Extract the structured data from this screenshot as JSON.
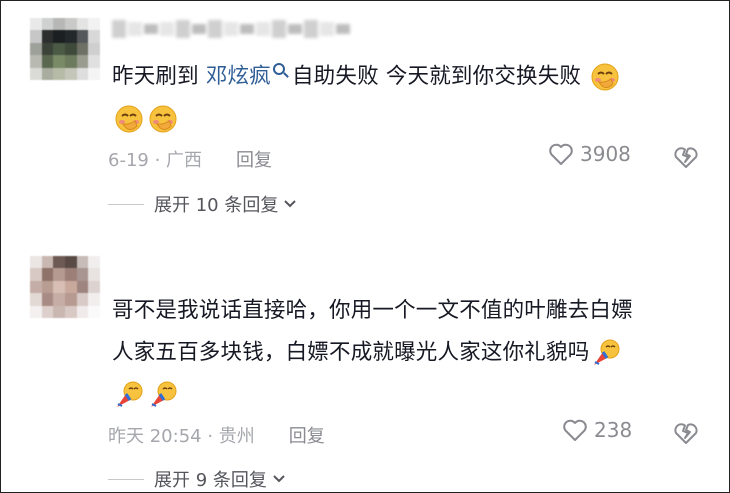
{
  "comments": [
    {
      "text_before": "昨天刷到 ",
      "mention": "邓炫疯",
      "text_after": " 自助失败 今天就到你交换失败",
      "date_location": "6-19 · 广西",
      "reply_label": "回复",
      "likes": "3908",
      "expand_label": "展开 10 条回复",
      "emoji_name": "blushing-hand-over-mouth"
    },
    {
      "line1": "哥不是我说话直接哈，你用一个一文不值的叶雕去白嫖",
      "line2": "人家五百多块钱，白嫖不成就曝光人家这你礼貌吗",
      "date_location": "昨天 20:54 · 贵州",
      "reply_label": "回复",
      "likes": "238",
      "expand_label": "展开 9 条回复",
      "emoji_name": "blowing-party-horn"
    }
  ],
  "colors": {
    "text": "#161823",
    "meta": "#a5a7ad",
    "mention": "#2f5e97"
  }
}
